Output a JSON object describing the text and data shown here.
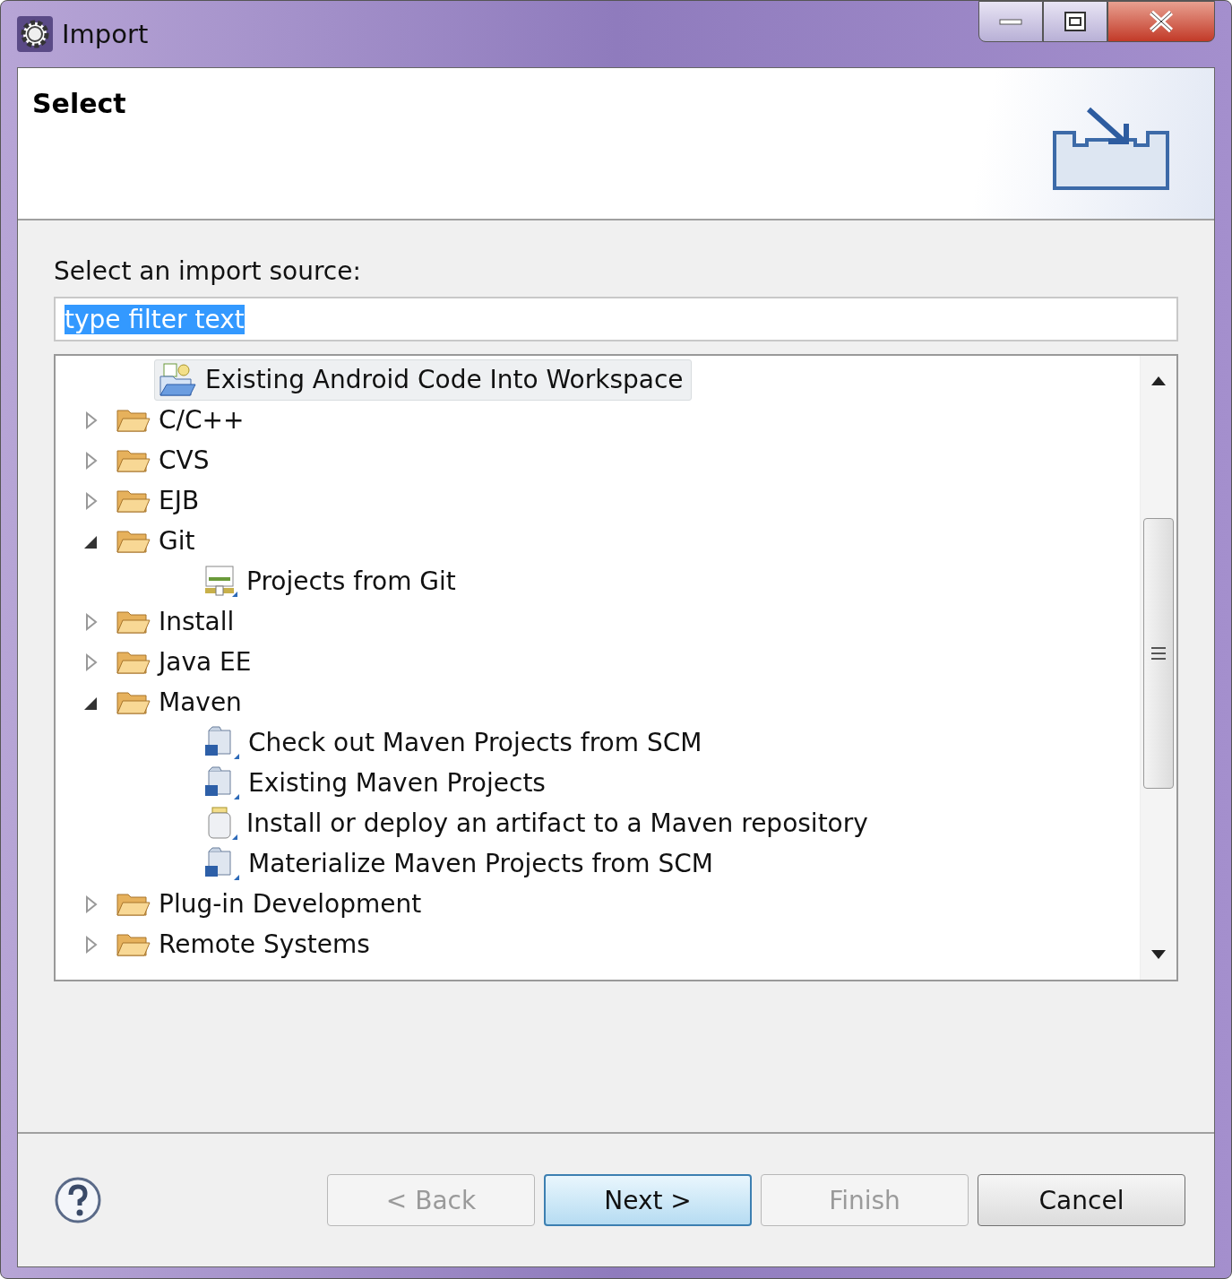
{
  "window": {
    "title": "Import"
  },
  "header": {
    "title": "Select"
  },
  "source": {
    "label": "Select an import source:"
  },
  "filter": {
    "value": "type filter text",
    "selected": true
  },
  "tree": [
    {
      "label": "Existing Android Code Into Workspace",
      "kind": "android",
      "selected": true
    },
    {
      "label": "C/C++",
      "kind": "folder",
      "expanded": false,
      "selected": false
    },
    {
      "label": "CVS",
      "kind": "folder",
      "expanded": false,
      "selected": false
    },
    {
      "label": "EJB",
      "kind": "folder",
      "expanded": false,
      "selected": false
    },
    {
      "label": "Git",
      "kind": "folder",
      "expanded": true,
      "selected": false,
      "children": [
        {
          "label": "Projects from Git",
          "kind": "git",
          "selected": false
        }
      ]
    },
    {
      "label": "Install",
      "kind": "folder",
      "expanded": false,
      "selected": false
    },
    {
      "label": "Java EE",
      "kind": "folder",
      "expanded": false,
      "selected": false
    },
    {
      "label": "Maven",
      "kind": "folder",
      "expanded": true,
      "selected": false,
      "children": [
        {
          "label": "Check out Maven Projects from SCM",
          "kind": "maven",
          "selected": false
        },
        {
          "label": "Existing Maven Projects",
          "kind": "maven",
          "selected": false
        },
        {
          "label": "Install or deploy an artifact to a Maven repository",
          "kind": "jar",
          "selected": false
        },
        {
          "label": "Materialize Maven Projects from SCM",
          "kind": "maven",
          "selected": false
        }
      ]
    },
    {
      "label": "Plug-in Development",
      "kind": "folder",
      "expanded": false,
      "selected": false
    },
    {
      "label": "Remote Systems",
      "kind": "folder",
      "expanded": false,
      "selected": false
    }
  ],
  "buttons": [
    {
      "label": "< Back",
      "disabled": true,
      "default": false
    },
    {
      "label": "Next >",
      "disabled": false,
      "default": true
    },
    {
      "label": "Finish",
      "disabled": true,
      "default": false
    },
    {
      "label": "Cancel",
      "disabled": false,
      "default": false
    }
  ]
}
